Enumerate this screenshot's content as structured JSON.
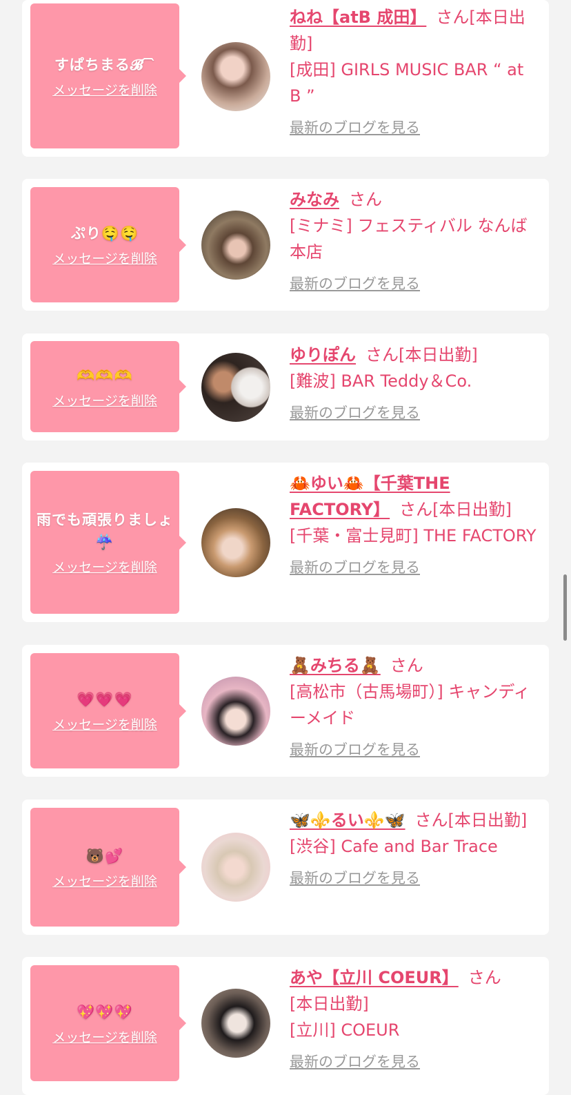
{
  "common": {
    "delete_label": "メッセージを削除",
    "blog_label": "最新のブログを見る",
    "san_label": "さん",
    "working_today_label": "[本日出勤]"
  },
  "colors": {
    "bubble": "#fe97a9",
    "accent": "#e5466e",
    "muted": "#999999",
    "background": "#f3f3f3"
  },
  "cards": [
    {
      "message": "すぱちまる𝓑 ᷇ ᷆",
      "name": "ねね【atB 成田】",
      "working_today": true,
      "shop": "[成田] GIRLS MUSIC BAR “ at B ”"
    },
    {
      "message": "ぷり🤤🤤",
      "name": "みなみ",
      "working_today": false,
      "shop": "[ミナミ] フェスティバル なんば本店"
    },
    {
      "message": "🫶🫶🫶",
      "name": "ゆりぽん",
      "working_today": true,
      "shop": "[難波] BAR Teddy＆Co."
    },
    {
      "message": "雨でも頑張りましょ☔️",
      "name": "🦀ゆい🦀【千葉THE FACTORY】",
      "working_today": true,
      "shop": "[千葉・富士見町] THE FACTORY"
    },
    {
      "message": "💗💗💗",
      "name": "🧸みちる🧸",
      "working_today": false,
      "shop": "[高松市（古馬場町）] キャンディーメイド"
    },
    {
      "message": "🐻💕",
      "name": "🦋⚜️るい⚜️🦋",
      "working_today": true,
      "shop": "[渋谷] Cafe and Bar Trace"
    },
    {
      "message": "💖💖💖",
      "name": "あや【立川 COEUR】",
      "working_today": true,
      "shop": "[立川] COEUR"
    }
  ]
}
